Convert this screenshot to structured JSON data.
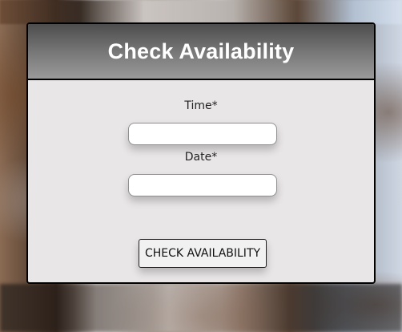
{
  "modal": {
    "title": "Check Availability",
    "fields": [
      {
        "label": "Time*",
        "value": "",
        "placeholder": ""
      },
      {
        "label": "Date*",
        "value": "",
        "placeholder": ""
      }
    ],
    "submit_label": "CHECK AVAILABILITY"
  }
}
